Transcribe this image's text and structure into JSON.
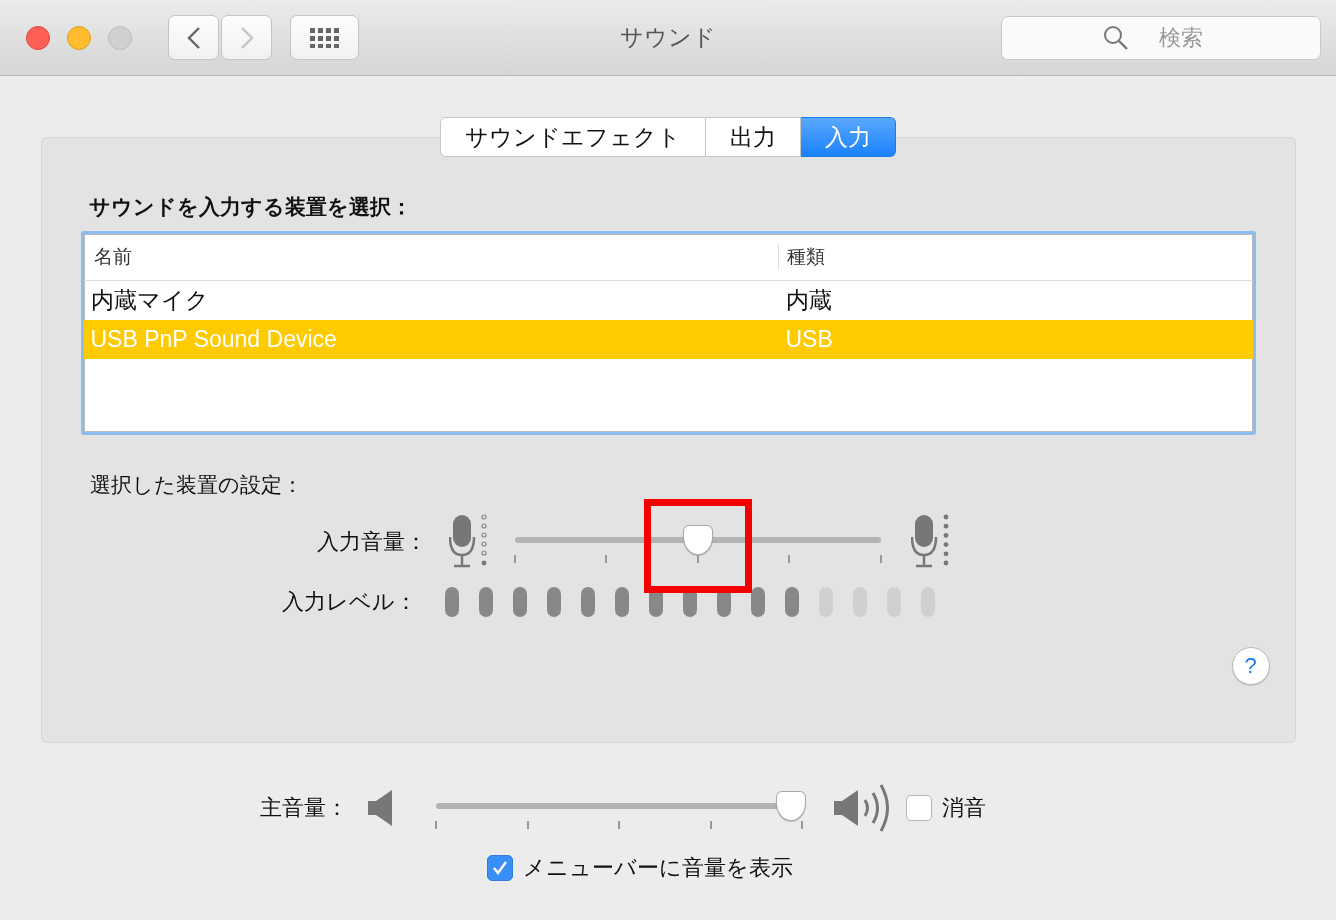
{
  "window": {
    "title": "サウンド",
    "back_disabled": false,
    "forward_disabled": true
  },
  "search": {
    "placeholder": "検索"
  },
  "tabs": [
    {
      "label": "サウンドエフェクト",
      "selected": false
    },
    {
      "label": "出力",
      "selected": false
    },
    {
      "label": "入力",
      "selected": true
    }
  ],
  "device_heading": "サウンドを入力する装置を選択：",
  "table": {
    "columns": [
      "名前",
      "種類"
    ],
    "rows": [
      {
        "cells": [
          "内蔵マイク",
          "内蔵"
        ],
        "selected": false
      },
      {
        "cells": [
          "USB PnP Sound Device",
          "USB"
        ],
        "selected": true
      }
    ]
  },
  "settings_heading": "選択した装置の設定：",
  "input_volume": {
    "label": "入力音量：",
    "level": 0.5,
    "highlighted": true
  },
  "input_level": {
    "label": "入力レベル：",
    "level": 0.733
  },
  "master_volume": {
    "label": "主音量：",
    "level": 0.97
  },
  "mute": {
    "label": "消音",
    "checked": false
  },
  "show_in_menu_bar": {
    "label": "メニューバーに音量を表示",
    "checked": true
  },
  "help_button": {
    "label": "?"
  }
}
